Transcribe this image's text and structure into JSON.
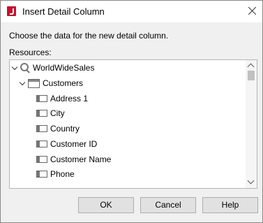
{
  "window": {
    "title": "Insert Detail Column",
    "close_icon": "close-icon",
    "app_icon": "report-app-icon"
  },
  "instructions": "Choose the data for the new detail column.",
  "resources_label": "Resources:",
  "tree": {
    "root": {
      "label": "WorldWideSales",
      "icon": "query-icon",
      "expanded": true
    },
    "table": {
      "label": "Customers",
      "icon": "table-icon",
      "expanded": true
    },
    "fields": [
      "Address 1",
      "City",
      "Country",
      "Customer ID",
      "Customer Name",
      "Phone"
    ]
  },
  "buttons": {
    "ok": "OK",
    "cancel": "Cancel",
    "help": "Help"
  }
}
